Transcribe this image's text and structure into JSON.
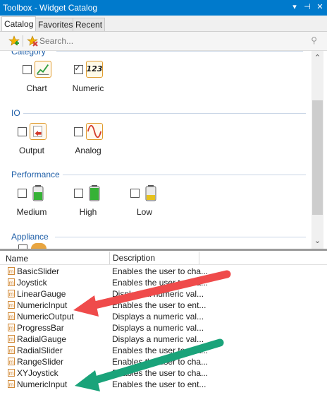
{
  "window": {
    "title": "Toolbox - Widget Catalog",
    "controls": [
      "▾",
      "⊣",
      "✕"
    ]
  },
  "tabs": [
    {
      "label": "Catalog",
      "active": true
    },
    {
      "label": "Favorites",
      "active": false
    },
    {
      "label": "Recent",
      "active": false
    }
  ],
  "toolbar": {
    "add_favorite_icon": "star-add-icon",
    "remove_favorite_icon": "star-remove-icon",
    "search_placeholder": "Search...",
    "search_icon": "magnifier-icon"
  },
  "catalog": {
    "groups": [
      {
        "name": "Category",
        "items": [
          {
            "label": "Chart",
            "checked": false,
            "icon": "chart-icon"
          },
          {
            "label": "Numeric",
            "checked": true,
            "icon": "numeric-icon",
            "icon_text": "123"
          }
        ]
      },
      {
        "name": "IO",
        "items": [
          {
            "label": "Output",
            "checked": false,
            "icon": "output-icon"
          },
          {
            "label": "Analog",
            "checked": false,
            "icon": "analog-wave-icon"
          }
        ]
      },
      {
        "name": "Performance",
        "items": [
          {
            "label": "Medium",
            "checked": false,
            "icon": "battery-medium-icon"
          },
          {
            "label": "High",
            "checked": false,
            "icon": "battery-high-icon"
          },
          {
            "label": "Low",
            "checked": false,
            "icon": "battery-low-icon"
          }
        ]
      },
      {
        "name": "Appliance",
        "items": []
      }
    ]
  },
  "widget_list": {
    "columns": [
      "Name",
      "Description"
    ],
    "rows": [
      {
        "name": "BasicSlider",
        "description": "Enables the user to cha..."
      },
      {
        "name": "Joystick",
        "description": "Enables the user to cha..."
      },
      {
        "name": "LinearGauge",
        "description": "Displays a numeric val..."
      },
      {
        "name": "NumericInput",
        "description": "Enables the user to ent..."
      },
      {
        "name": "NumericOutput",
        "description": "Displays a numeric val..."
      },
      {
        "name": "ProgressBar",
        "description": "Displays a numeric val..."
      },
      {
        "name": "RadialGauge",
        "description": "Displays a numeric val..."
      },
      {
        "name": "RadialSlider",
        "description": "Enables the user to cha..."
      },
      {
        "name": "RangeSlider",
        "description": "Enables the user to cha..."
      },
      {
        "name": "XYJoystick",
        "description": "Enables the user to cha..."
      },
      {
        "name": "NumericInput",
        "description": "Enables the user to ent..."
      }
    ]
  },
  "colors": {
    "titlebar": "#007acc",
    "group_header": "#1f5fa8",
    "red_arrow": "#ef4b4b",
    "green_arrow": "#1aa37a"
  }
}
